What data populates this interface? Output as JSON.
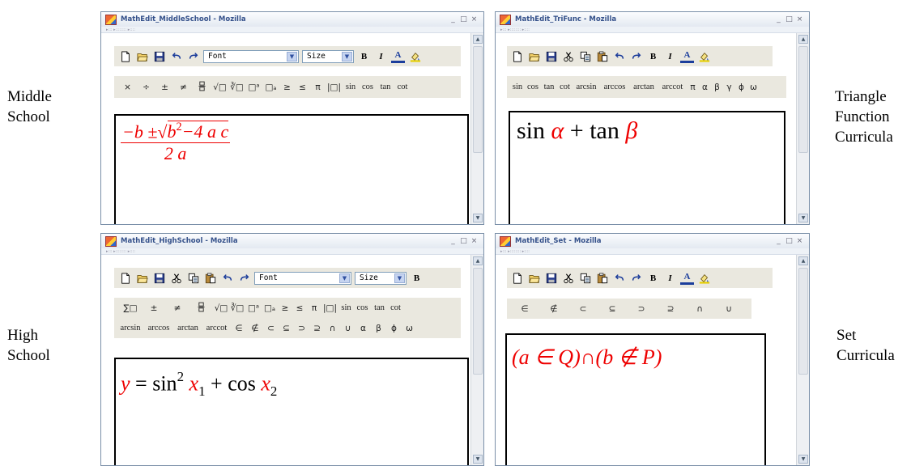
{
  "side_labels": {
    "top_left": [
      "Middle",
      "School"
    ],
    "top_right": [
      "Triangle",
      "Function",
      "Curricula"
    ],
    "bottom_left": [
      "High",
      "School"
    ],
    "bottom_right": [
      "Set",
      "Curricula"
    ]
  },
  "window_controls": {
    "minimize": "_",
    "maximize": "□",
    "close": "×"
  },
  "menu_strip": "▸:::  ▸::::::::  ▸:::: ",
  "font_select": {
    "value": "Font",
    "arrow": "▼"
  },
  "size_select": {
    "value": "Size",
    "arrow": "▼"
  },
  "format_buttons": {
    "bold": "B",
    "italic": "I",
    "color": "A"
  },
  "scroll": {
    "up": "▲",
    "down": "▼"
  },
  "windows": {
    "middle_school": {
      "title": "MathEdit_MiddleSchool - Mozilla",
      "symbols": [
        "×",
        "÷",
        "±",
        "≠",
        "fraction",
        "√□",
        "∛□",
        "□ᵃ",
        "□ₐ",
        "≥",
        "≤",
        "π",
        "|□|",
        "sin",
        "cos",
        "tan",
        "cot"
      ],
      "formula": {
        "numerator_left": "−b ±",
        "radicand_b": "b",
        "radicand_exp": "2",
        "radicand_rest": "−4 a c",
        "denominator": "2 a"
      }
    },
    "triangle_function": {
      "title": "MathEdit_TriFunc - Mozilla",
      "symbols": [
        "sin",
        "cos",
        "tan",
        "cot",
        "arcsin",
        "arccos",
        "arctan",
        "arccot",
        "π",
        "α",
        "β",
        "γ",
        "ϕ",
        "ω"
      ],
      "formula": {
        "fn1": "sin",
        "var1": "α",
        "op": "+",
        "fn2": "tan",
        "var2": "β"
      }
    },
    "high_school": {
      "title": "MathEdit_HighSchool - Mozilla",
      "symbols_row1": [
        "∑□",
        "±",
        "≠",
        "fraction",
        "√□",
        "∛□",
        "□ᵃ",
        "□ₐ",
        "≥",
        "≤",
        "π",
        "|□|",
        "sin",
        "cos",
        "tan",
        "cot"
      ],
      "symbols_row2": [
        "arcsin",
        "arccos",
        "arctan",
        "arccot",
        "∈",
        "∉",
        "⊂",
        "⊆",
        "⊃",
        "⊇",
        "∩",
        "∪",
        "α",
        "β",
        "ϕ",
        "ω"
      ],
      "formula": {
        "lhs": "y",
        "eq": "=",
        "fn1": "sin",
        "exp": "2",
        "var1": "x",
        "sub1": "1",
        "op": "+",
        "fn2": "cos",
        "var2": "x",
        "sub2": "2"
      }
    },
    "set": {
      "title": "MathEdit_Set - Mozilla",
      "symbols": [
        "∈",
        "∉",
        "⊂",
        "⊆",
        "⊃",
        "⊇",
        "∩",
        "∪"
      ],
      "formula": {
        "part1": "(a ∈ Q)",
        "cap": "∩",
        "part2": "(b ∉ P)"
      }
    }
  }
}
